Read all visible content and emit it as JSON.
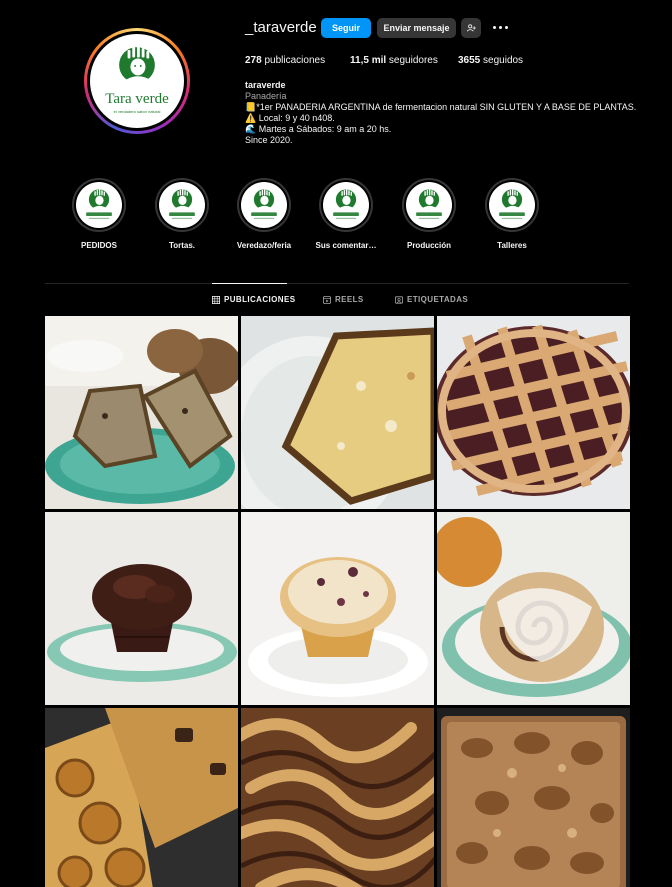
{
  "profile": {
    "username": "_taraverde",
    "follow_label": "Seguir",
    "message_label": "Enviar mensaje",
    "add_label": "+",
    "posts_count": "278",
    "posts_label": "publicaciones",
    "followers_count": "11,5 mil",
    "followers_label": "seguidores",
    "following_count": "3655",
    "following_label": "seguidos",
    "logo_text": "Tara verde",
    "logo_subtext": "el verdadero sabor natural"
  },
  "bio": {
    "name": "taraverde",
    "category": "Panadería",
    "lines": [
      "📒*1er PANADERIA ARGENTINA de fermentacion natural SIN GLUTEN Y A BASE DE PLANTAS.",
      "⚠️ Local: 9 y 40 n408.",
      "🌊 Martes a Sábados: 9 am a 20 hs.",
      "Since 2020."
    ]
  },
  "highlights": [
    {
      "label": "PEDIDOS"
    },
    {
      "label": "Tortas."
    },
    {
      "label": "Veredazo/feria"
    },
    {
      "label": "Sus comentar…"
    },
    {
      "label": "Producción"
    },
    {
      "label": "Talleres"
    }
  ],
  "tabs": [
    {
      "label": "PUBLICACIONES",
      "icon": "grid-icon",
      "active": true
    },
    {
      "label": "REELS",
      "icon": "reels-icon",
      "active": false
    },
    {
      "label": "ETIQUETADAS",
      "icon": "tagged-icon",
      "active": false
    }
  ],
  "posts": [
    {
      "subject": "banana bread slices on green plate"
    },
    {
      "subject": "cake slice on tara verde plate"
    },
    {
      "subject": "lattice tart"
    },
    {
      "subject": "chocolate muffin"
    },
    {
      "subject": "sugared muffin"
    },
    {
      "subject": "glazed cinnamon roll"
    },
    {
      "subject": "orange loaf cakes"
    },
    {
      "subject": "marbled brownie"
    },
    {
      "subject": "focaccia tray"
    }
  ],
  "colors": {
    "background": "#000000",
    "follow_button": "#0095f6",
    "secondary_button": "#363636",
    "brand_green": "#1f7a2e",
    "muted_text": "#a8a8a8"
  }
}
